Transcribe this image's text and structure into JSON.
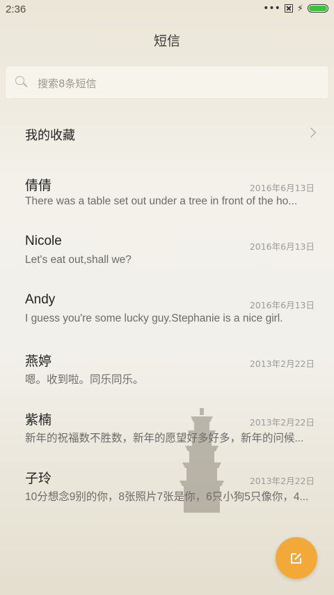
{
  "status_bar": {
    "time": "2:36"
  },
  "header": {
    "title": "短信"
  },
  "search": {
    "placeholder": "搜索8条短信"
  },
  "favorites": {
    "label": "我的收藏"
  },
  "conversations": [
    {
      "name": "倩倩",
      "date": "2016年6月13日",
      "preview": "There was a table set out under a tree in front of the ho..."
    },
    {
      "name": "Nicole",
      "date": "2016年6月13日",
      "preview": "Let's eat out,shall we?"
    },
    {
      "name": "Andy",
      "date": "2016年6月13日",
      "preview": "I guess you're some lucky guy.Stephanie is a nice girl."
    },
    {
      "name": "燕婷",
      "date": "2013年2月22日",
      "preview": "嗯。收到啦。同乐同乐。"
    },
    {
      "name": "紫楠",
      "date": "2013年2月22日",
      "preview": "新年的祝福数不胜数，新年的愿望好多好多，新年的问候..."
    },
    {
      "name": "子玲",
      "date": "2013年2月22日",
      "preview": "10分想念9别的你，8张照片7张是你，6只小狗5只像你，4..."
    }
  ],
  "colors": {
    "accent": "#f3a93a",
    "battery": "#39c43a"
  }
}
